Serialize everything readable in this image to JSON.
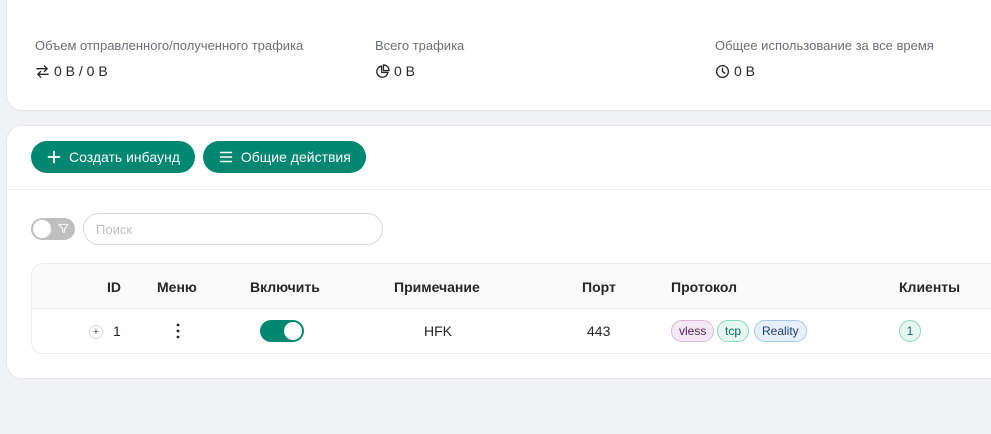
{
  "stats": {
    "traffic_io": {
      "label": "Объем отправленного/полученного трафика",
      "value": "0 B / 0 B",
      "icon": "swap-icon"
    },
    "total_traffic": {
      "label": "Всего трафика",
      "value": "0 B",
      "icon": "pie-chart-icon"
    },
    "total_usage": {
      "label": "Общее использование за все время",
      "value": "0 B",
      "icon": "clock-icon"
    }
  },
  "toolbar": {
    "create_label": "Создать инбаунд",
    "actions_label": "Общие действия"
  },
  "search": {
    "placeholder": "Поиск",
    "value": ""
  },
  "table": {
    "columns": [
      "ID",
      "Меню",
      "Включить",
      "Примечание",
      "Порт",
      "Протокол",
      "Клиенты"
    ],
    "rows": [
      {
        "id": "1",
        "enabled": true,
        "remark": "HFK",
        "port": "443",
        "protocol_tags": [
          "vless",
          "tcp",
          "Reality"
        ],
        "clients": "1"
      }
    ]
  },
  "colors": {
    "accent": "#008771",
    "background": "#f0f2f5",
    "tag_vless": "#531d55",
    "tag_tcp": "#00705a",
    "tag_reality": "#1d3f73"
  }
}
